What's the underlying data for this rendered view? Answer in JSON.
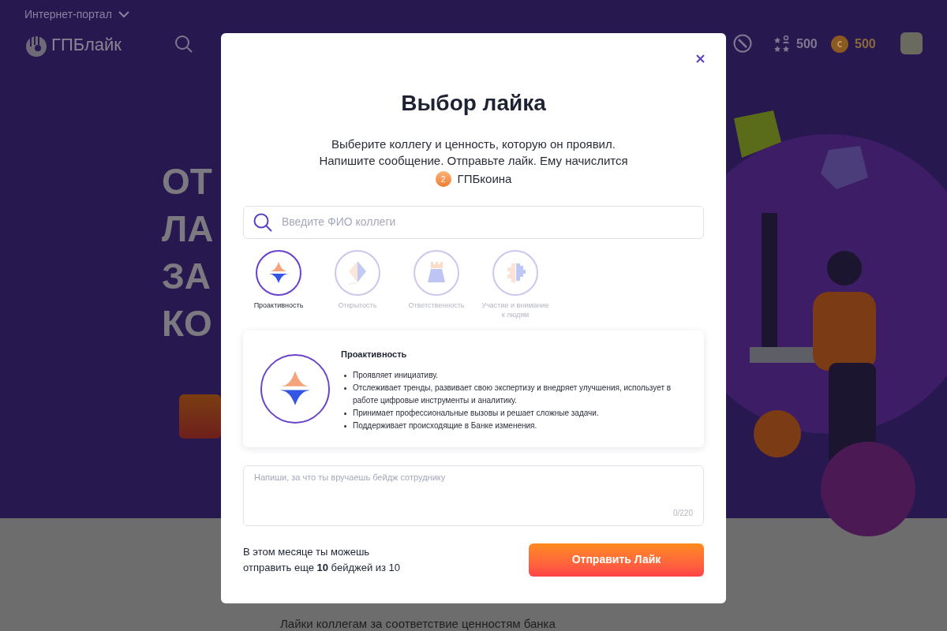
{
  "header": {
    "portal_menu": "Интернет-портал",
    "logo": "ГПБлайк",
    "stars_count": "500",
    "coins_count": "500"
  },
  "hero": {
    "title_lines": [
      "ОТ",
      "ЛА",
      "ЗА",
      "КО"
    ]
  },
  "section": {
    "subtitle": "Лайки коллегам за соответствие ценностям банка"
  },
  "modal": {
    "title": "Выбор лайка",
    "description": "Выберите коллегу и ценность, которую он проявил. Напишите сообщение. Отправьте лайк. Ему начислится",
    "coin_amount": "2",
    "coin_label": "ГПБкоина",
    "search": {
      "placeholder": "Введите ФИО коллеги"
    },
    "values": [
      {
        "kind": "proactivity",
        "label": "Проактивность",
        "selected": true
      },
      {
        "kind": "openness",
        "label": "Открытость",
        "selected": false
      },
      {
        "kind": "responsibility",
        "label": "Ответственность",
        "selected": false
      },
      {
        "kind": "care",
        "label": "Участие и внимание к людям",
        "selected": false
      }
    ],
    "details": {
      "kind": "proactivity",
      "title": "Проактивность",
      "points": [
        "Проявляет инициативу.",
        "Отслеживает тренды, развивает свою экспертизу и внедряет улучшения, использует в работе цифровые инструменты и аналитику.",
        "Принимает профессиональные вызовы и решает сложные задачи.",
        "Поддерживает происходящие в Банке изменения."
      ]
    },
    "message": {
      "placeholder": "Напиши, за что ты вручаешь бейдж сотруднику",
      "counter": "0/220"
    },
    "quota": "В этом месяце ты можешь отправить еще **10** бейджей из 10",
    "submit": "Отправить Лайк"
  }
}
